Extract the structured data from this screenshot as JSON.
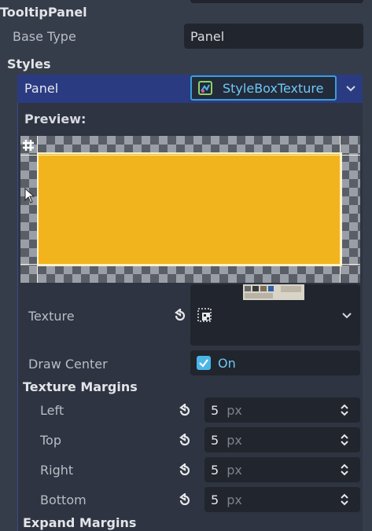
{
  "top": {
    "class_name": "TooltipPanel",
    "base_type_label": "Base Type",
    "base_type_value": "Panel"
  },
  "styles": {
    "title": "Styles",
    "panel_label": "Panel",
    "stylebox_value": "StyleBoxTexture",
    "preview_label": "Preview:",
    "preview_fill_color": "#f2b41d"
  },
  "properties": {
    "texture_label": "Texture",
    "draw_center_label": "Draw Center",
    "draw_center_value": "On",
    "texture_margins_title": "Texture Margins",
    "margins": [
      {
        "label": "Left",
        "value": "5",
        "unit": "px"
      },
      {
        "label": "Top",
        "value": "5",
        "unit": "px"
      },
      {
        "label": "Right",
        "value": "5",
        "unit": "px"
      },
      {
        "label": "Bottom",
        "value": "5",
        "unit": "px"
      }
    ],
    "expand_margins_title": "Expand Margins"
  },
  "icons": {
    "revert": "revert-icon",
    "chevron": "chevron-down-icon",
    "spinner": "spinner-arrows-icon",
    "grid": "grid-icon",
    "cursor": "cursor-icon",
    "texture": "texture-icon"
  },
  "colors": {
    "accent": "#3a9fd6",
    "header_bg": "#2a3b82",
    "checkbox": "#4ab6e8"
  }
}
